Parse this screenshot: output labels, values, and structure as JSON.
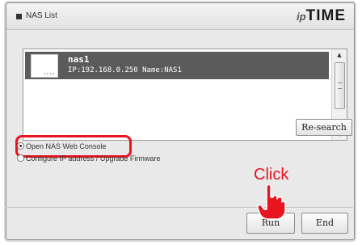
{
  "window": {
    "title": "NAS List",
    "logo_prefix": "ip",
    "logo_main": "TIME"
  },
  "nas_list": {
    "items": [
      {
        "name": "nas1",
        "info": "IP:192.168.0.250  Name:NAS1",
        "icon_label": "....",
        "selected": true
      }
    ]
  },
  "buttons": {
    "research": "Re-search",
    "run": "Run",
    "end": "End"
  },
  "options": [
    {
      "label": "Open NAS Web Console",
      "selected": true
    },
    {
      "label": "Configure IP address / Upgrade Firmware",
      "selected": false
    }
  ],
  "annotation": {
    "click_text": "Click",
    "color": "#e8141f"
  },
  "colors": {
    "selected_row": "#5b5b5b",
    "window_bg": "#e9e9e9"
  }
}
